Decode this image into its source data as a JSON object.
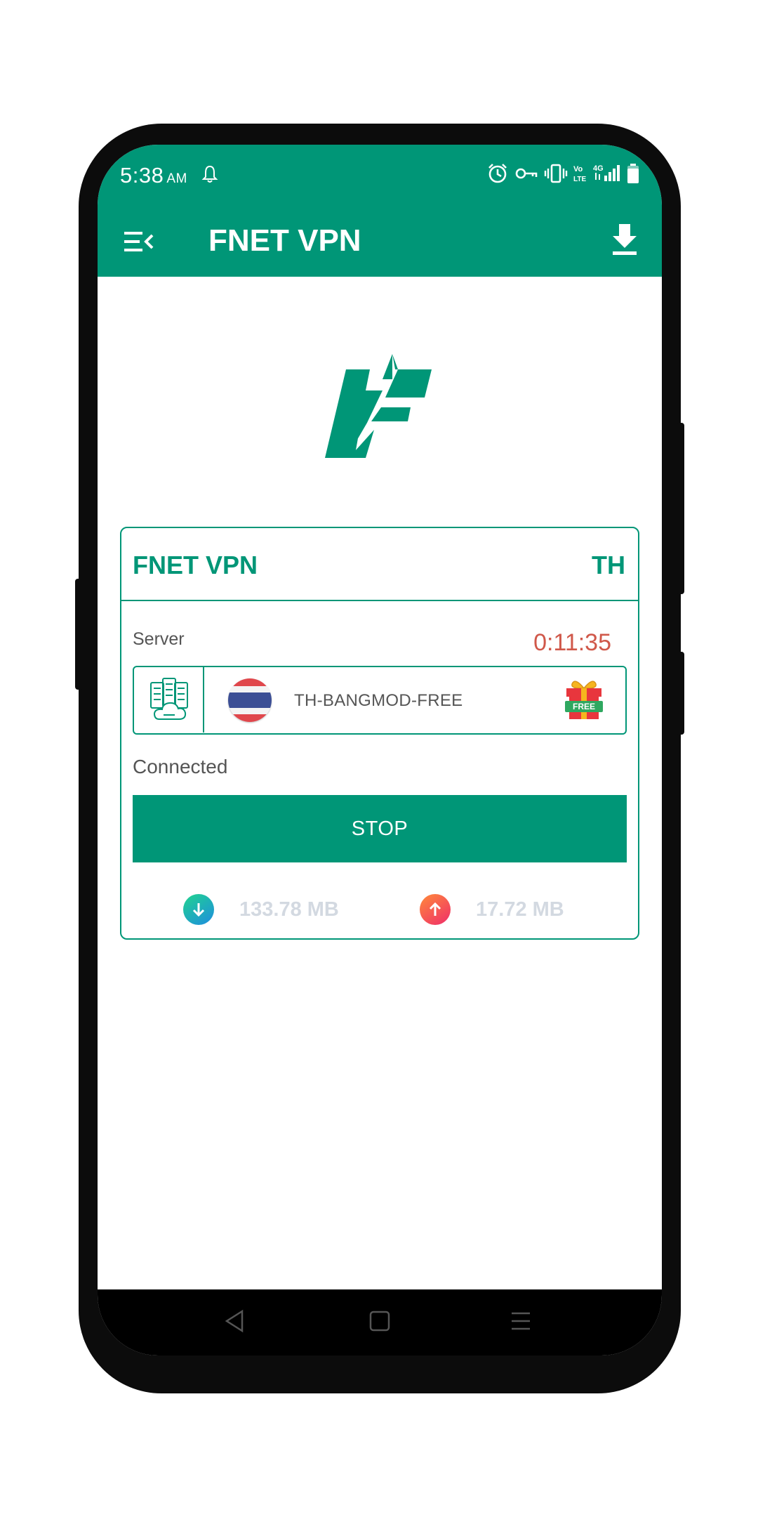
{
  "status_bar": {
    "time": "5:38",
    "ampm": "AM",
    "icons": [
      "bell-icon",
      "alarm-icon",
      "vpn-key-icon",
      "vibrate-icon",
      "volte-icon",
      "4g-icon",
      "signal-icon",
      "battery-icon"
    ]
  },
  "app_bar": {
    "title": "FNET VPN",
    "menu_icon": "menu-icon",
    "download_icon": "download-icon"
  },
  "card": {
    "title": "FNET VPN",
    "country_code": "TH",
    "server_label": "Server",
    "timer": "0:11:35",
    "server_name": "TH-BANGMOD-FREE",
    "status": "Connected",
    "button_label": "STOP",
    "download": "133.78 MB",
    "upload": "17.72 MB",
    "badge_text": "FREE"
  },
  "colors": {
    "primary": "#009677",
    "timer": "#d0584a",
    "traffic_text": "#d3d9e1"
  }
}
